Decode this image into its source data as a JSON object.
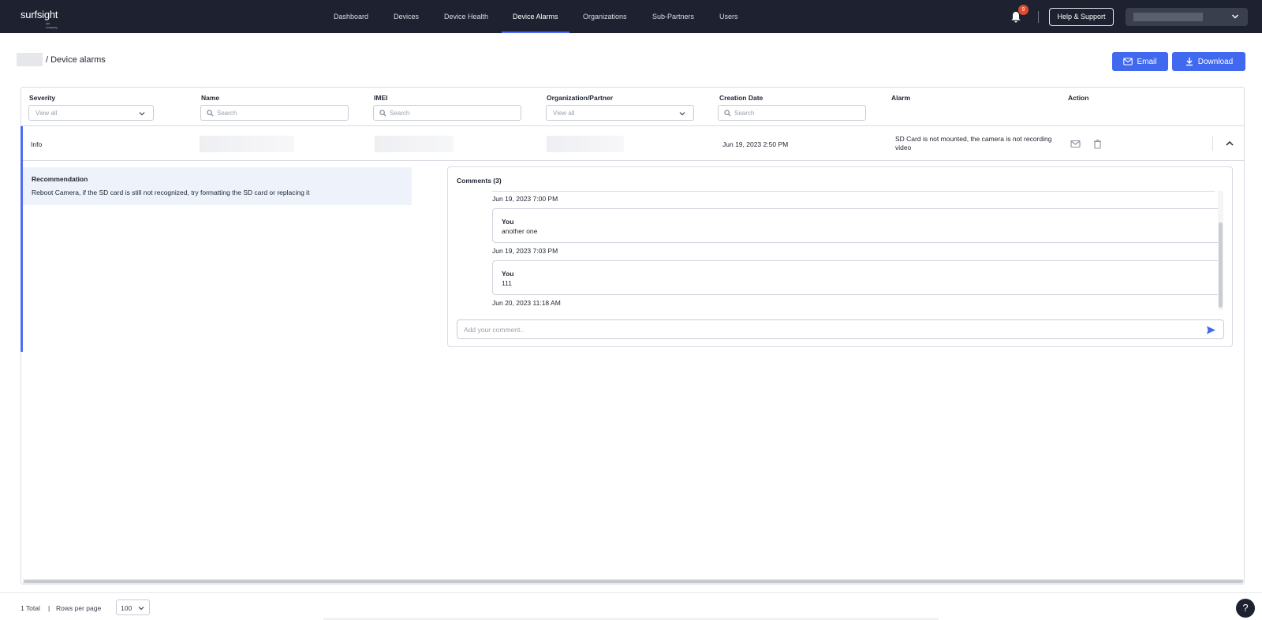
{
  "app": {
    "logo": "surfsight",
    "logo_sub": "lytx company"
  },
  "nav": {
    "items": [
      {
        "label": "Dashboard"
      },
      {
        "label": "Devices"
      },
      {
        "label": "Device Health"
      },
      {
        "label": "Device Alarms",
        "active": true
      },
      {
        "label": "Organizations"
      },
      {
        "label": "Sub-Partners"
      },
      {
        "label": "Users"
      }
    ],
    "notifications_count": "9",
    "help_label": "Help & Support"
  },
  "breadcrumb": {
    "current": "/ Device alarms"
  },
  "toolbar": {
    "email_label": "Email",
    "download_label": "Download"
  },
  "table": {
    "columns": [
      "Severity",
      "Name",
      "IMEI",
      "Organization/Partner",
      "Creation Date",
      "Alarm",
      "Action"
    ],
    "filters": {
      "severity_value": "View all",
      "name_placeholder": "Search",
      "imei_placeholder": "Search",
      "org_value": "View all",
      "date_placeholder": "Search"
    },
    "rows": [
      {
        "severity": "Info",
        "creation_date": "Jun 19, 2023 2:50 PM",
        "alarm": "SD Card is not mounted, the camera is not recording video"
      }
    ]
  },
  "detail": {
    "recommendation_title": "Recommendation",
    "recommendation_text": "Reboot Camera, if the SD card is still not recognized, try formatting the SD card or replacing it",
    "comments_title": "Comments (3)",
    "comments": [
      {
        "timestamp": "Jun 19, 2023 7:00 PM",
        "author": "You",
        "text": "another one"
      },
      {
        "timestamp": "Jun 19, 2023 7:03 PM",
        "author": "You",
        "text": "111"
      },
      {
        "timestamp": "Jun 20, 2023 11:18 AM"
      }
    ],
    "comment_placeholder": "Add your comment.."
  },
  "footer": {
    "total": "1 Total",
    "separator": "|",
    "rows_per_page_label": "Rows per page",
    "rows_per_page_value": "100"
  },
  "help_fab": "?",
  "colors": {
    "nav_bg": "#1e2230",
    "accent": "#4169f0",
    "badge": "#e0492b",
    "reco_bg": "#eef3fb"
  }
}
